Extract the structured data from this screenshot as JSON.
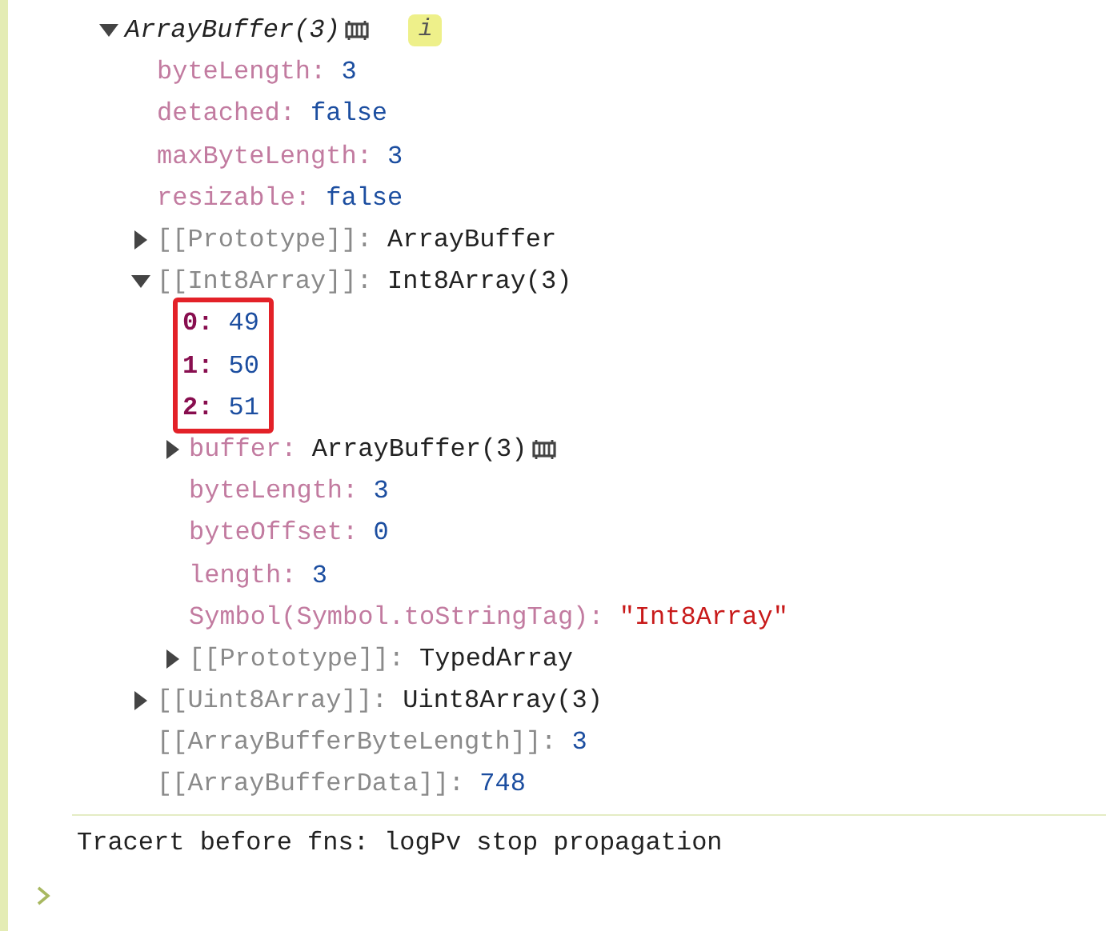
{
  "tree": {
    "kind": "property",
    "value": {
      "text": "ArrayBuffer(3)",
      "kind": "preview"
    },
    "expanded": true,
    "inspect_memory": true,
    "badge": "i",
    "children": [
      {
        "kind": "property",
        "key": {
          "text": "byteLength:",
          "kind": "own"
        },
        "value": {
          "text": "3",
          "kind": "number"
        }
      },
      {
        "kind": "property",
        "key": {
          "text": "detached:",
          "kind": "own"
        },
        "value": {
          "text": "false",
          "kind": "boolean"
        }
      },
      {
        "kind": "property",
        "key": {
          "text": "maxByteLength:",
          "kind": "own"
        },
        "value": {
          "text": "3",
          "kind": "number"
        }
      },
      {
        "kind": "property",
        "key": {
          "text": "resizable:",
          "kind": "own"
        },
        "value": {
          "text": "false",
          "kind": "boolean"
        }
      },
      {
        "kind": "property",
        "key": {
          "text": "[[Prototype]]:",
          "kind": "internal"
        },
        "value": {
          "text": "ArrayBuffer",
          "kind": "object"
        },
        "expanded": false
      },
      {
        "kind": "property",
        "key": {
          "text": "[[Int8Array]]:",
          "kind": "internal"
        },
        "value": {
          "text": "Int8Array(3)",
          "kind": "object"
        },
        "expanded": true,
        "children": [
          {
            "kind": "highlight_box",
            "rows": [
              {
                "kind": "property",
                "key": {
                  "text": "0:",
                  "kind": "index"
                },
                "value": {
                  "text": "49",
                  "kind": "number"
                }
              },
              {
                "kind": "property",
                "key": {
                  "text": "1:",
                  "kind": "index"
                },
                "value": {
                  "text": "50",
                  "kind": "number"
                }
              },
              {
                "kind": "property",
                "key": {
                  "text": "2:",
                  "kind": "index"
                },
                "value": {
                  "text": "51",
                  "kind": "number"
                }
              }
            ]
          },
          {
            "kind": "property",
            "key": {
              "text": "buffer:",
              "kind": "own"
            },
            "value": {
              "text": "ArrayBuffer(3)",
              "kind": "object"
            },
            "expanded": false,
            "inspect_memory": true
          },
          {
            "kind": "property",
            "key": {
              "text": "byteLength:",
              "kind": "own"
            },
            "value": {
              "text": "3",
              "kind": "number"
            }
          },
          {
            "kind": "property",
            "key": {
              "text": "byteOffset:",
              "kind": "own"
            },
            "value": {
              "text": "0",
              "kind": "number"
            }
          },
          {
            "kind": "property",
            "key": {
              "text": "length:",
              "kind": "own"
            },
            "value": {
              "text": "3",
              "kind": "number"
            }
          },
          {
            "kind": "property",
            "key": {
              "text": "Symbol(Symbol.toStringTag):",
              "kind": "own"
            },
            "value": {
              "text": "\"Int8Array\"",
              "kind": "string"
            }
          },
          {
            "kind": "property",
            "key": {
              "text": "[[Prototype]]:",
              "kind": "internal"
            },
            "value": {
              "text": "TypedArray",
              "kind": "object"
            },
            "expanded": false
          }
        ]
      },
      {
        "kind": "property",
        "key": {
          "text": "[[Uint8Array]]:",
          "kind": "internal"
        },
        "value": {
          "text": "Uint8Array(3)",
          "kind": "object"
        },
        "expanded": false
      },
      {
        "kind": "property",
        "key": {
          "text": "[[ArrayBufferByteLength]]:",
          "kind": "internal"
        },
        "value": {
          "text": "3",
          "kind": "number"
        }
      },
      {
        "kind": "property",
        "key": {
          "text": "[[ArrayBufferData]]:",
          "kind": "internal"
        },
        "value": {
          "text": "748",
          "kind": "number"
        }
      }
    ]
  },
  "message": "Tracert before fns: logPv stop propagation"
}
